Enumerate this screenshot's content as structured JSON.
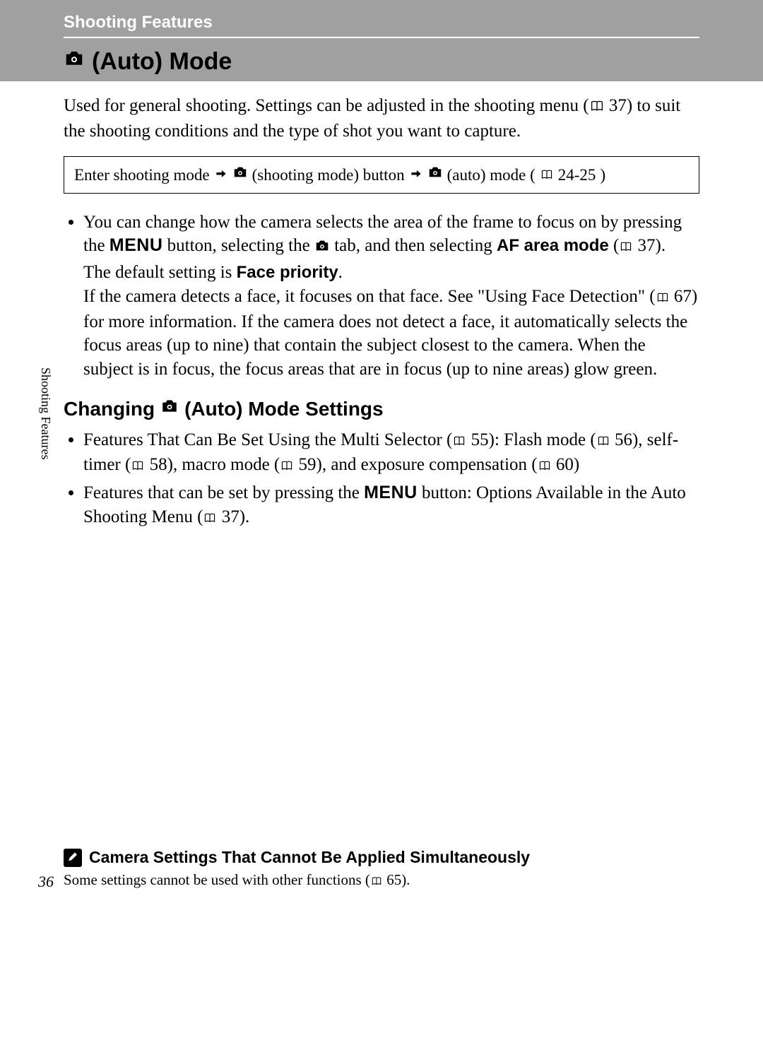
{
  "header": {
    "breadcrumb": "Shooting Features",
    "title": " (Auto) Mode"
  },
  "intro": {
    "p1_a": "Used for general shooting. Settings can be adjusted in the shooting menu (",
    "p1_ref": " 37",
    "p1_b": ") to suit the shooting conditions and the type of shot you want to capture."
  },
  "navbox": {
    "t1": "Enter shooting mode",
    "t2": "(shooting mode) button",
    "t3": "(auto) mode (",
    "ref": " 24-25",
    "t4": ")"
  },
  "bullet1": {
    "a": "You can change how the camera selects the area of the frame to focus on by pressing the ",
    "menu": "MENU",
    "b": " button, selecting the ",
    "c": " tab, and then selecting ",
    "af": "AF area mode",
    "d": " (",
    "ref1": " 37",
    "e": ").",
    "line2a": "The default setting is ",
    "fp": "Face priority",
    "line2b": ".",
    "line3a": "If the camera detects a face, it focuses on that face. See \"Using Face Detection\" (",
    "ref2": " 67",
    "line3b": ") for more information. If the camera does not detect a face, it automatically selects the focus areas (up to nine) that contain the subject closest to the camera. When the subject is in focus, the focus areas that are in focus (up to nine areas) glow green."
  },
  "subheading": {
    "a": "Changing ",
    "b": " (Auto) Mode Settings"
  },
  "bullet2": {
    "a": "Features That Can Be Set Using the Multi Selector (",
    "r55": " 55",
    "b": "): Flash mode (",
    "r56": " 56",
    "c": "), self-timer (",
    "r58": " 58",
    "d": "), macro mode (",
    "r59": " 59",
    "e": "), and exposure compensation (",
    "r60": " 60",
    "f": ")"
  },
  "bullet3": {
    "a": "Features that can be set by pressing the ",
    "menu": "MENU",
    "b": " button: Options Available in the Auto Shooting Menu (",
    "r37": " 37",
    "c": ")."
  },
  "sidebar": "Shooting Features",
  "page_number": "36",
  "footer": {
    "heading": "Camera Settings That Cannot Be Applied Simultaneously",
    "body_a": "Some settings cannot be used with other functions (",
    "ref": " 65",
    "body_b": ")."
  }
}
